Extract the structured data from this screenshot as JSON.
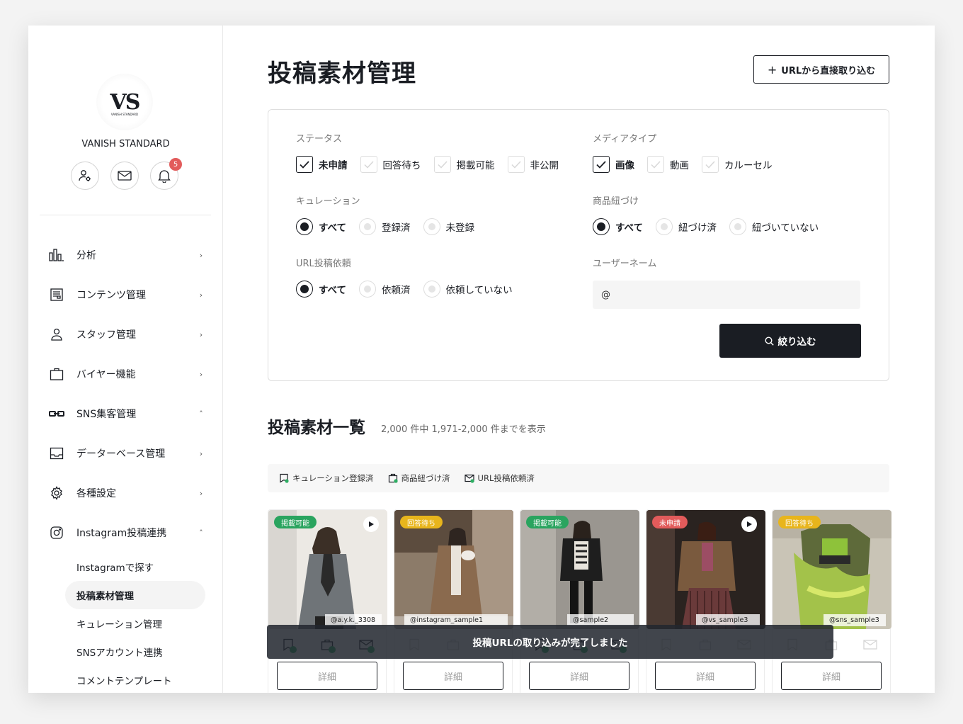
{
  "sidebar": {
    "brand_name": "VANISH STANDARD",
    "logo_text": "VS",
    "logo_subtext": "VANISH STANDARD",
    "notification_count": "5",
    "nav_items": [
      {
        "label": "分析",
        "icon": "bar-chart-icon",
        "chevron": "›"
      },
      {
        "label": "コンテンツ管理",
        "icon": "content-icon",
        "chevron": "›"
      },
      {
        "label": "スタッフ管理",
        "icon": "person-icon",
        "chevron": "›"
      },
      {
        "label": "バイヤー機能",
        "icon": "briefcase-icon",
        "chevron": "›"
      },
      {
        "label": "SNS集客管理",
        "icon": "link-icon",
        "chevron": "˄"
      },
      {
        "label": "データーベース管理",
        "icon": "inbox-icon",
        "chevron": "›"
      },
      {
        "label": "各種設定",
        "icon": "gear-icon",
        "chevron": "›"
      },
      {
        "label": "Instagram投稿連携",
        "icon": "instagram-icon",
        "chevron": "˄"
      }
    ],
    "sub_items": [
      {
        "label": "Instagramで探す"
      },
      {
        "label": "投稿素材管理"
      },
      {
        "label": "キュレーション管理"
      },
      {
        "label": "SNSアカウント連携"
      },
      {
        "label": "コメントテンプレート"
      }
    ]
  },
  "main": {
    "title": "投稿素材管理",
    "url_import_button": "URLから直接取り込む",
    "filters": {
      "status": {
        "label": "ステータス",
        "options": [
          "未申請",
          "回答待ち",
          "掲載可能",
          "非公開"
        ]
      },
      "media_type": {
        "label": "メディアタイプ",
        "options": [
          "画像",
          "動画",
          "カルーセル"
        ]
      },
      "curation": {
        "label": "キュレーション",
        "options": [
          "すべて",
          "登録済",
          "未登録"
        ]
      },
      "product_link": {
        "label": "商品紐づけ",
        "options": [
          "すべて",
          "紐づけ済",
          "紐づいていない"
        ]
      },
      "url_request": {
        "label": "URL投稿依頼",
        "options": [
          "すべて",
          "依頼済",
          "依頼していない"
        ]
      },
      "username": {
        "label": "ユーザーネーム",
        "value": "@"
      },
      "submit_label": "絞り込む"
    },
    "list": {
      "title": "投稿素材一覧",
      "count_text": "2,000 件中 1,971-2,000 件までを表示",
      "legend": [
        "キュレーション登録済",
        "商品紐づけ済",
        "URL投稿依頼済"
      ]
    },
    "cards": [
      {
        "status": "掲載可能",
        "handle": "@a.y.k._3308",
        "detail": "詳細"
      },
      {
        "status": "回答待ち",
        "handle": "@instagram_sample1",
        "detail": "詳細"
      },
      {
        "status": "掲載可能",
        "handle": "@sample2",
        "detail": "詳細"
      },
      {
        "status": "未申請",
        "handle": "@vs_sample3",
        "detail": "詳細"
      },
      {
        "status": "回答待ち",
        "handle": "@sns_sample3",
        "detail": "詳細"
      }
    ],
    "toast": "投稿URLの取り込みが完了しました"
  },
  "colors": {
    "green": "#2aa45f",
    "yellow": "#e8b51c",
    "red": "#e25b5b",
    "dark": "#1a1d23"
  }
}
